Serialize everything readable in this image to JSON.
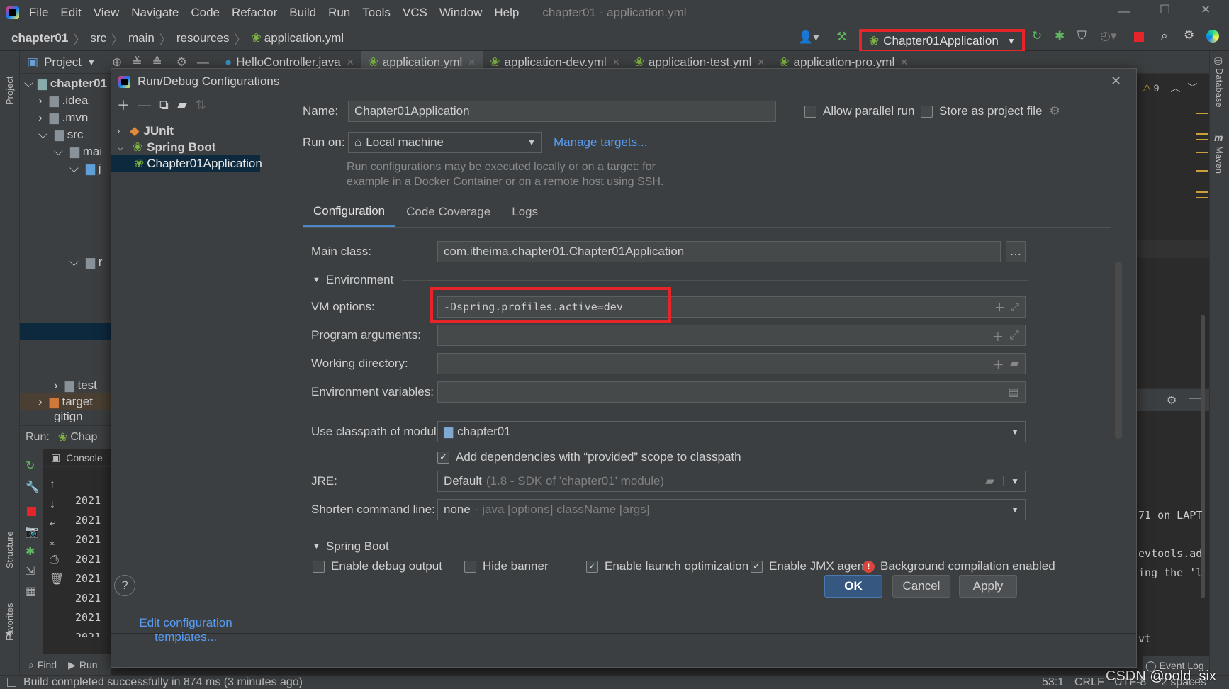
{
  "menubar": {
    "items": [
      "File",
      "Edit",
      "View",
      "Navigate",
      "Code",
      "Refactor",
      "Build",
      "Run",
      "Tools",
      "VCS",
      "Window",
      "Help"
    ],
    "window_title": "chapter01 - application.yml"
  },
  "breadcrumb": {
    "items": [
      "chapter01",
      "src",
      "main",
      "resources",
      "application.yml"
    ]
  },
  "toolbar": {
    "run_config": "Chapter01Application"
  },
  "editor_tabs": [
    "HelloController.java",
    "application.yml",
    "application-dev.yml",
    "application-test.yml",
    "application-pro.yml"
  ],
  "project_panel": {
    "title": "Project",
    "root": "chapter01",
    "items": [
      ".idea",
      ".mvn",
      "src",
      "mai",
      "j",
      "r",
      "test",
      "target",
      "gitign"
    ]
  },
  "run_panel": {
    "label": "Run:",
    "config": "Chap",
    "console_tab": "Console",
    "log_lines": [
      "2021",
      "2021",
      "2021",
      "2021",
      "2021",
      "2021",
      "2021",
      "2021"
    ]
  },
  "right_tool": {
    "database": "Database",
    "maven": "Maven"
  },
  "editor_right": {
    "warnings": "9",
    "text_lines": [
      "71 on LAPT",
      "evtools.ad",
      "ing the 'l",
      "vt"
    ]
  },
  "left_tool": {
    "project": "Project",
    "structure": "Structure",
    "favorites": "Favorites"
  },
  "bottom_tools": {
    "find": "Find",
    "run": "Run",
    "event_log": "Event Log"
  },
  "statusbar": {
    "message": "Build completed successfully in 874 ms (3 minutes ago)",
    "position": "53:1",
    "line_sep": "CRLF",
    "encoding": "UTF-8",
    "indent": "2 spaces",
    "watermark": "CSDN @oold_six"
  },
  "dialog": {
    "title": "Run/Debug Configurations",
    "tree": {
      "junit": "JUnit",
      "spring_boot": "Spring Boot",
      "app": "Chapter01Application"
    },
    "edit_templates": "Edit configuration templates...",
    "name_label": "Name:",
    "name_value": "Chapter01Application",
    "allow_parallel": "Allow parallel run",
    "store_project": "Store as project file",
    "run_on_label": "Run on:",
    "run_on_value": "Local machine",
    "manage_targets": "Manage targets...",
    "run_on_hint_1": "Run configurations may be executed locally or on a target: for",
    "run_on_hint_2": "example in a Docker Container or on a remote host using SSH.",
    "tabs": [
      "Configuration",
      "Code Coverage",
      "Logs"
    ],
    "main_class_label": "Main class:",
    "main_class_value": "com.itheima.chapter01.Chapter01Application",
    "environment_section": "Environment",
    "vm_options_label": "VM options:",
    "vm_options_value": "-Dspring.profiles.active=dev",
    "program_args_label": "Program arguments:",
    "working_dir_label": "Working directory:",
    "env_vars_label": "Environment variables:",
    "classpath_label": "Use classpath of module:",
    "classpath_value": "chapter01",
    "add_deps": "Add dependencies with “provided” scope to classpath",
    "jre_label": "JRE:",
    "jre_value": "Default",
    "jre_hint": "(1.8 - SDK of 'chapter01' module)",
    "shorten_label": "Shorten command line:",
    "shorten_value": "none",
    "shorten_hint": "- java [options] className [args]",
    "spring_boot_section": "Spring Boot",
    "enable_debug": "Enable debug output",
    "hide_banner": "Hide banner",
    "enable_launch": "Enable launch optimization",
    "enable_jmx": "Enable JMX agent",
    "bg_compile": "Background compilation enabled",
    "ok": "OK",
    "cancel": "Cancel",
    "apply": "Apply",
    "help": "?"
  },
  "colors": {
    "highlight": "#e5252a",
    "accent": "#589df6",
    "selected": "#0d293e",
    "ok_button": "#365880"
  }
}
